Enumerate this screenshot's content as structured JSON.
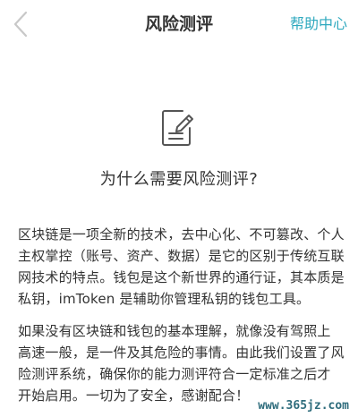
{
  "nav": {
    "title": "风险测评",
    "help_label": "帮助中心"
  },
  "icons": {
    "back": "chevron-left-icon",
    "hero": "edit-document-icon"
  },
  "content": {
    "heading": "为什么需要风险测评?",
    "paragraph_1": [
      "区块链是一项全新的技术，去中心化、不可篡改、个人",
      "主权掌控（账号、资产、数据）是它的区别于传统互联",
      "网技术的特点。钱包是这个新世界的通行证，其本质是",
      "私钥，imToken 是辅助你管理私钥的钱包工具。"
    ],
    "paragraph_2": [
      "如果没有区块链和钱包的基本理解，就像没有驾照上",
      "高速一般，是一件及其危险的事情。由此我们设置了风",
      "险测评系统，确保你的能力测评符合一定标准之后才",
      "开始启用。一切为了安全，感谢配合！"
    ]
  },
  "watermark": "www.365jz.com",
  "colors": {
    "accent": "#2fa9bf",
    "text": "#333333",
    "icon_stroke": "#555555",
    "back_arrow": "#c8c8c8"
  }
}
